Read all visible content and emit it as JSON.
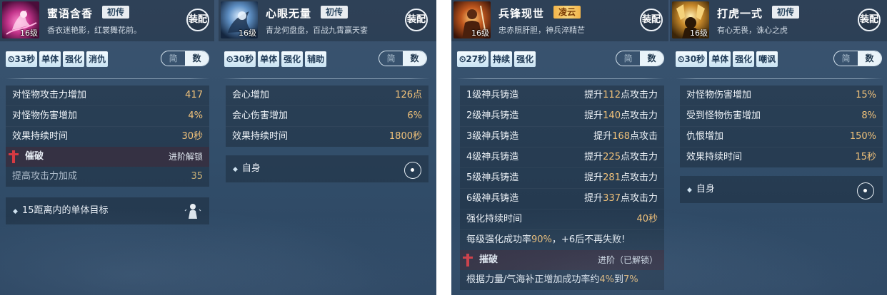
{
  "colors": {
    "panel_bg": "#34506c",
    "stat_value": "#f1c27a",
    "tag_bg": "#dff0fa",
    "rank_gold": "#f5c35c",
    "break_bar": "#d63a42"
  },
  "left_panel": {
    "cards": [
      {
        "name": "蜜语含香",
        "rank": "初传",
        "level": "16级",
        "desc": "香衣迷艳影，红裳舞花前。",
        "equip": "装配",
        "portrait_icon": "pink-dancer-portrait-icon",
        "cooldown": "33秒",
        "tags": [
          "单体",
          "强化",
          "消仇"
        ],
        "toggle": {
          "off": "简",
          "on": "数"
        },
        "stats": [
          {
            "label": "对怪物攻击力增加",
            "value": "417"
          },
          {
            "label": "对怪物伤害增加",
            "value": "4%"
          },
          {
            "label": "效果持续时间",
            "value": "30秒"
          }
        ],
        "break": {
          "title": "催破",
          "status": "进阶解锁"
        },
        "break_stat": {
          "label": "提高攻击力加成",
          "value": "35"
        },
        "target": "15距离内的单体目标"
      },
      {
        "name": "心眼无量",
        "rank": "初传",
        "level": "16级",
        "desc": "青龙何盘盘，百战九霄赢天銮",
        "equip": "装配",
        "portrait_icon": "blue-dragon-portrait-icon",
        "cooldown": "30秒",
        "tags": [
          "单体",
          "强化",
          "辅助"
        ],
        "toggle": {
          "off": "简",
          "on": "数"
        },
        "stats": [
          {
            "label": "会心增加",
            "value": "126点"
          },
          {
            "label": "会心伤害增加",
            "value": "6%"
          },
          {
            "label": "效果持续时间",
            "value": "1800秒"
          }
        ],
        "target": "自身"
      }
    ]
  },
  "right_panel": {
    "cards": [
      {
        "name": "兵锋现世",
        "rank": "凌云",
        "level": "16级",
        "desc": "忠赤照肝胆，神兵淬精芒",
        "equip": "装配",
        "portrait_icon": "warrior-flame-portrait-icon",
        "cooldown": "27秒",
        "tags": [
          "持续",
          "强化"
        ],
        "toggle": {
          "off": "简",
          "on": "数"
        },
        "stats": [
          {
            "label": "1级神兵铸造",
            "pre": "提升",
            "num": "112",
            "post": "点攻击力"
          },
          {
            "label": "2级神兵铸造",
            "pre": "提升",
            "num": "140",
            "post": "点攻击力"
          },
          {
            "label": "3级神兵铸造",
            "pre": "提升",
            "num": "168",
            "post": "点攻击"
          },
          {
            "label": "4级神兵铸造",
            "pre": "提升",
            "num": "225",
            "post": "点攻击力"
          },
          {
            "label": "5级神兵铸造",
            "pre": "提升",
            "num": "281",
            "post": "点攻击力"
          },
          {
            "label": "6级神兵铸造",
            "pre": "提升",
            "num": "337",
            "post": "点攻击力"
          }
        ],
        "duration": {
          "label": "强化持续时间",
          "value": "40秒"
        },
        "rate_line": {
          "pre": "每级强化成功率",
          "num": "90%",
          "post": "，+6后不再失败!"
        },
        "break": {
          "title": "摧破",
          "status": "进阶（已解锁）"
        },
        "bonus_line": {
          "pre": "根据力量/气海补正增加成功率约",
          "a": "4%",
          "mid": "到",
          "b": "7%"
        }
      },
      {
        "name": "打虎一式",
        "rank": "初传",
        "level": "16级",
        "desc": "有心无畏，诛心之虎",
        "equip": "装配",
        "portrait_icon": "golden-axe-portrait-icon",
        "cooldown": "30秒",
        "tags": [
          "单体",
          "强化",
          "嘲讽"
        ],
        "toggle": {
          "off": "简",
          "on": "数"
        },
        "stats": [
          {
            "label": "对怪物伤害增加",
            "value": "15%"
          },
          {
            "label": "受到怪物伤害增加",
            "value": "8%"
          },
          {
            "label": "仇恨增加",
            "value": "150%"
          },
          {
            "label": "效果持续时间",
            "value": "15秒"
          }
        ],
        "target": "自身"
      }
    ]
  }
}
